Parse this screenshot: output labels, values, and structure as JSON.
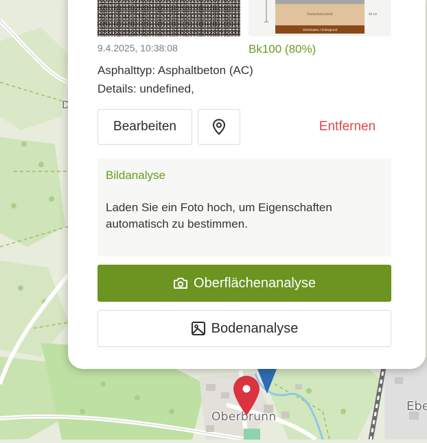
{
  "map": {
    "town_label": "Oberbrunn",
    "edge_label": "Ebe",
    "edge_left_label": "D"
  },
  "card": {
    "timestamp": "9.4.2025, 10:38:08",
    "classification": "Bk100 (80%)",
    "asphalt_type": "Asphalttyp: Asphaltbeton (AC)",
    "details": "Details: undefined,",
    "layer_labels": [
      "Frostschutzschicht",
      "40 cm",
      "Unterboden / Untergrund"
    ],
    "buttons": {
      "edit": "Bearbeiten",
      "remove": "Entfernen",
      "location_icon": "map-pin-icon"
    },
    "image_analysis": {
      "title": "Bildanalyse",
      "text": "Laden Sie ein Foto hoch, um Eigenschaften automatisch zu bestimmen."
    },
    "surface_button": {
      "label": "Oberflächenanalyse",
      "icon": "camera-icon"
    },
    "soil_button": {
      "label": "Bodenanalyse",
      "icon": "image-icon"
    }
  },
  "colors": {
    "accent_green": "#6b9420",
    "remove_red": "#e04646",
    "pin_red": "#d9343f",
    "pin_blue": "#2d6cb5"
  }
}
